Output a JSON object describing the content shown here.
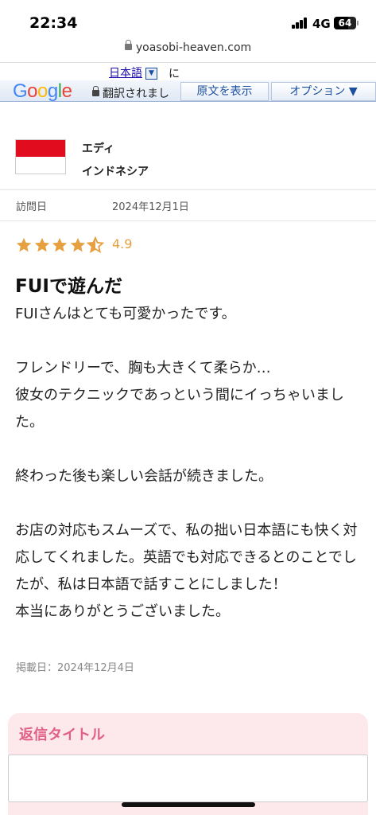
{
  "status": {
    "time": "22:34",
    "network": "4G",
    "battery": "64"
  },
  "browser": {
    "url": "yoasobi-heaven.com"
  },
  "translate_bar": {
    "language": "日本語",
    "ni": "に",
    "status_text": "翻訳されまし",
    "show_original_label": "原文を表示",
    "options_label": "オプション ▼"
  },
  "reviewer": {
    "name": "エディ",
    "country": "インドネシア"
  },
  "visit": {
    "label": "訪問日",
    "date": "2024年12月1日"
  },
  "rating": {
    "value": "4.9",
    "stars_full": 4,
    "stars_partial": 0.9,
    "star_color": "#e6a040"
  },
  "review": {
    "title": "FUIで遊んだ",
    "body": [
      "FUIさんはとても可愛かったです。",
      "",
      "フレンドリーで、胸も大きくて柔らか…",
      "彼女のテクニックであっという間にイっちゃいました。",
      "",
      "終わった後も楽しい会話が続きました。",
      "",
      "お店の対応もスムーズで、私の拙い日本語にも快く対応してくれました。英語でも対応できるとのことでしたが、私は日本語で話すことにしました！",
      "本当にありがとうございました。"
    ],
    "posted": "掲載日：2024年12月4日"
  },
  "reply": {
    "title": "返信タイトル"
  }
}
